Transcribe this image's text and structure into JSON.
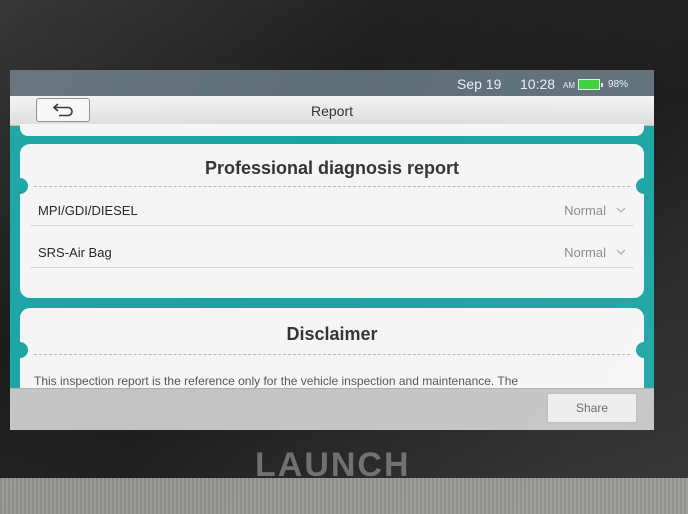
{
  "device": {
    "brand": "LAUNCH"
  },
  "status_bar": {
    "date": "Sep 19",
    "time": "10:28",
    "ampm": "AM",
    "battery": "98%"
  },
  "header": {
    "title": "Report",
    "back_icon": "back-arrow-icon"
  },
  "report_card": {
    "heading": "Professional diagnosis report",
    "rows": [
      {
        "label": "MPI/GDI/DIESEL",
        "value": "Normal",
        "icon": "chevron-down-icon"
      },
      {
        "label": "SRS-Air Bag",
        "value": "Normal",
        "icon": "chevron-down-icon"
      }
    ]
  },
  "disclaimer_card": {
    "heading": "Disclaimer",
    "text": "This inspection report is the reference only for the vehicle inspection and maintenance. The"
  },
  "footer": {
    "share_label": "Share"
  },
  "colors": {
    "accent": "#18a3a3",
    "status_bar": "#5f6f7a",
    "battery": "#3ad13a"
  }
}
